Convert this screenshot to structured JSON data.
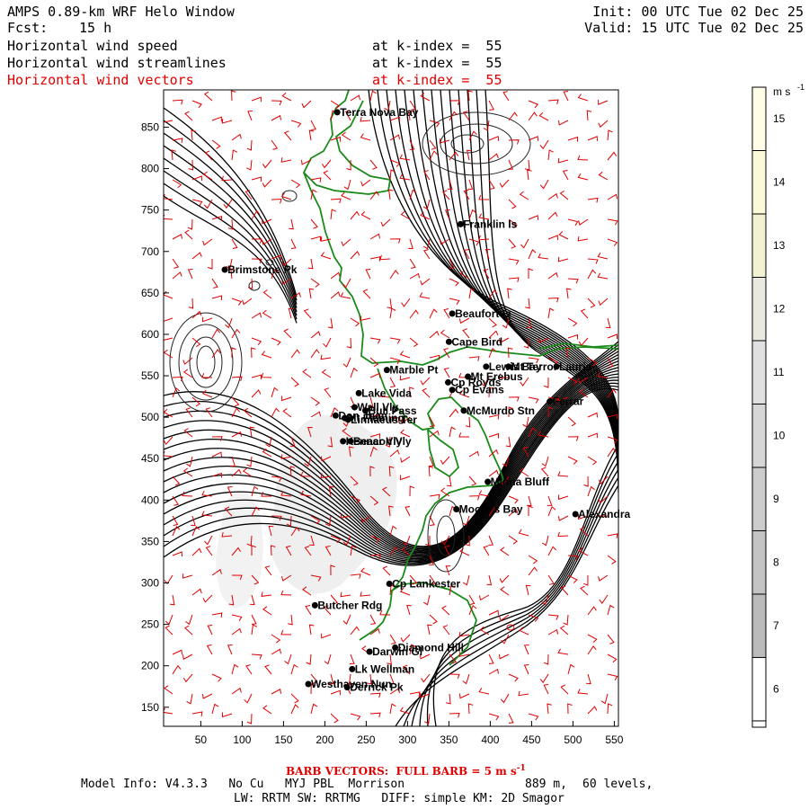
{
  "header": {
    "title": "AMPS 0.89-km WRF Helo Window",
    "fcst_label": "Fcst:",
    "fcst_value": "15 h",
    "init": "Init: 00 UTC Tue 02 Dec 25",
    "valid": "Valid: 15 UTC Tue 02 Dec 25"
  },
  "fields": [
    {
      "name": "Horizontal wind speed",
      "level": "at k-index =  55",
      "color": "#000000"
    },
    {
      "name": "Horizontal wind streamlines",
      "level": "at k-index =  55",
      "color": "#000000"
    },
    {
      "name": "Horizontal wind vectors",
      "level": "at k-index =  55",
      "color": "#e00000"
    }
  ],
  "axes": {
    "x_ticks": [
      "50",
      "100",
      "150",
      "200",
      "250",
      "300",
      "350",
      "400",
      "450",
      "500",
      "550"
    ],
    "y_ticks": [
      "850",
      "800",
      "750",
      "700",
      "650",
      "600",
      "550",
      "500",
      "450",
      "400",
      "350",
      "300",
      "250",
      "200",
      "150"
    ]
  },
  "colorbar": {
    "unit": "m s",
    "unit_exp": "-1",
    "levels": [
      "15",
      "14",
      "13",
      "12",
      "11",
      "10",
      "9",
      "8",
      "7",
      "6"
    ],
    "colors": [
      "#fffde6",
      "#fbfad8",
      "#f2f2d2",
      "#e9e9e0",
      "#e0e0e0",
      "#d6d6d6",
      "#cccccc",
      "#c3c3c3",
      "#bababa",
      "#ffffff"
    ]
  },
  "places": [
    {
      "name": "Terra Nova Bay",
      "x": 215,
      "y": 868
    },
    {
      "name": "Franklin Is",
      "x": 364,
      "y": 733
    },
    {
      "name": "Brimstone Pk",
      "x": 79,
      "y": 678
    },
    {
      "name": "Beaufort Is",
      "x": 354,
      "y": 625
    },
    {
      "name": "Cape Bird",
      "x": 350,
      "y": 591
    },
    {
      "name": "Marble Pt",
      "x": 275,
      "y": 557
    },
    {
      "name": "Lewis Bay",
      "x": 395,
      "y": 561
    },
    {
      "name": "Mt Terror",
      "x": 422,
      "y": 561
    },
    {
      "name": "Laurie",
      "x": 480,
      "y": 561
    },
    {
      "name": "Cp Royds",
      "x": 349,
      "y": 542
    },
    {
      "name": "Mt Erebus",
      "x": 373,
      "y": 549
    },
    {
      "name": "Cp Evans",
      "x": 354,
      "y": 533
    },
    {
      "name": "Lake Vida",
      "x": 241,
      "y": 529
    },
    {
      "name": "Wall Vly",
      "x": 236,
      "y": 512
    },
    {
      "name": "Bull Pass",
      "x": 249,
      "y": 508
    },
    {
      "name": "McMurdo Stn",
      "x": 368,
      "y": 508
    },
    {
      "name": "Ferrar",
      "x": 472,
      "y": 519
    },
    {
      "name": "Don Juan",
      "x": 213,
      "y": 502
    },
    {
      "name": "Mt Fleming",
      "x": 224,
      "y": 499
    },
    {
      "name": "Linnaeus Ter",
      "x": 228,
      "y": 497
    },
    {
      "name": "Kennar Vly",
      "x": 222,
      "y": 471
    },
    {
      "name": "Beacon Vly",
      "x": 231,
      "y": 471
    },
    {
      "name": "Minna Bluff",
      "x": 397,
      "y": 422
    },
    {
      "name": "Moore's Bay",
      "x": 359,
      "y": 389
    },
    {
      "name": "Alexandra",
      "x": 503,
      "y": 383
    },
    {
      "name": "Cp Lankester",
      "x": 278,
      "y": 299
    },
    {
      "name": "Butcher Rdg",
      "x": 188,
      "y": 273
    },
    {
      "name": "Diamond Hill",
      "x": 285,
      "y": 222
    },
    {
      "name": "Darwin Gl",
      "x": 254,
      "y": 217
    },
    {
      "name": "Lk Wellman",
      "x": 233,
      "y": 196
    },
    {
      "name": "Westhaven Nun",
      "x": 180,
      "y": 178
    },
    {
      "name": "Derrick Pk",
      "x": 227,
      "y": 174
    }
  ],
  "barb_note": "BARB VECTORS:  FULL BARB = 5 m s",
  "barb_note_exp": "-1",
  "model_info": {
    "line1": "Model Info: V4.3.3   No Cu   MYJ PBL  Morrison",
    "resolution": "889 m,",
    "levels": "60 levels,",
    "line2": "LW: RRTM SW: RRTMG   DIFF: simple KM: 2D Smagor"
  }
}
